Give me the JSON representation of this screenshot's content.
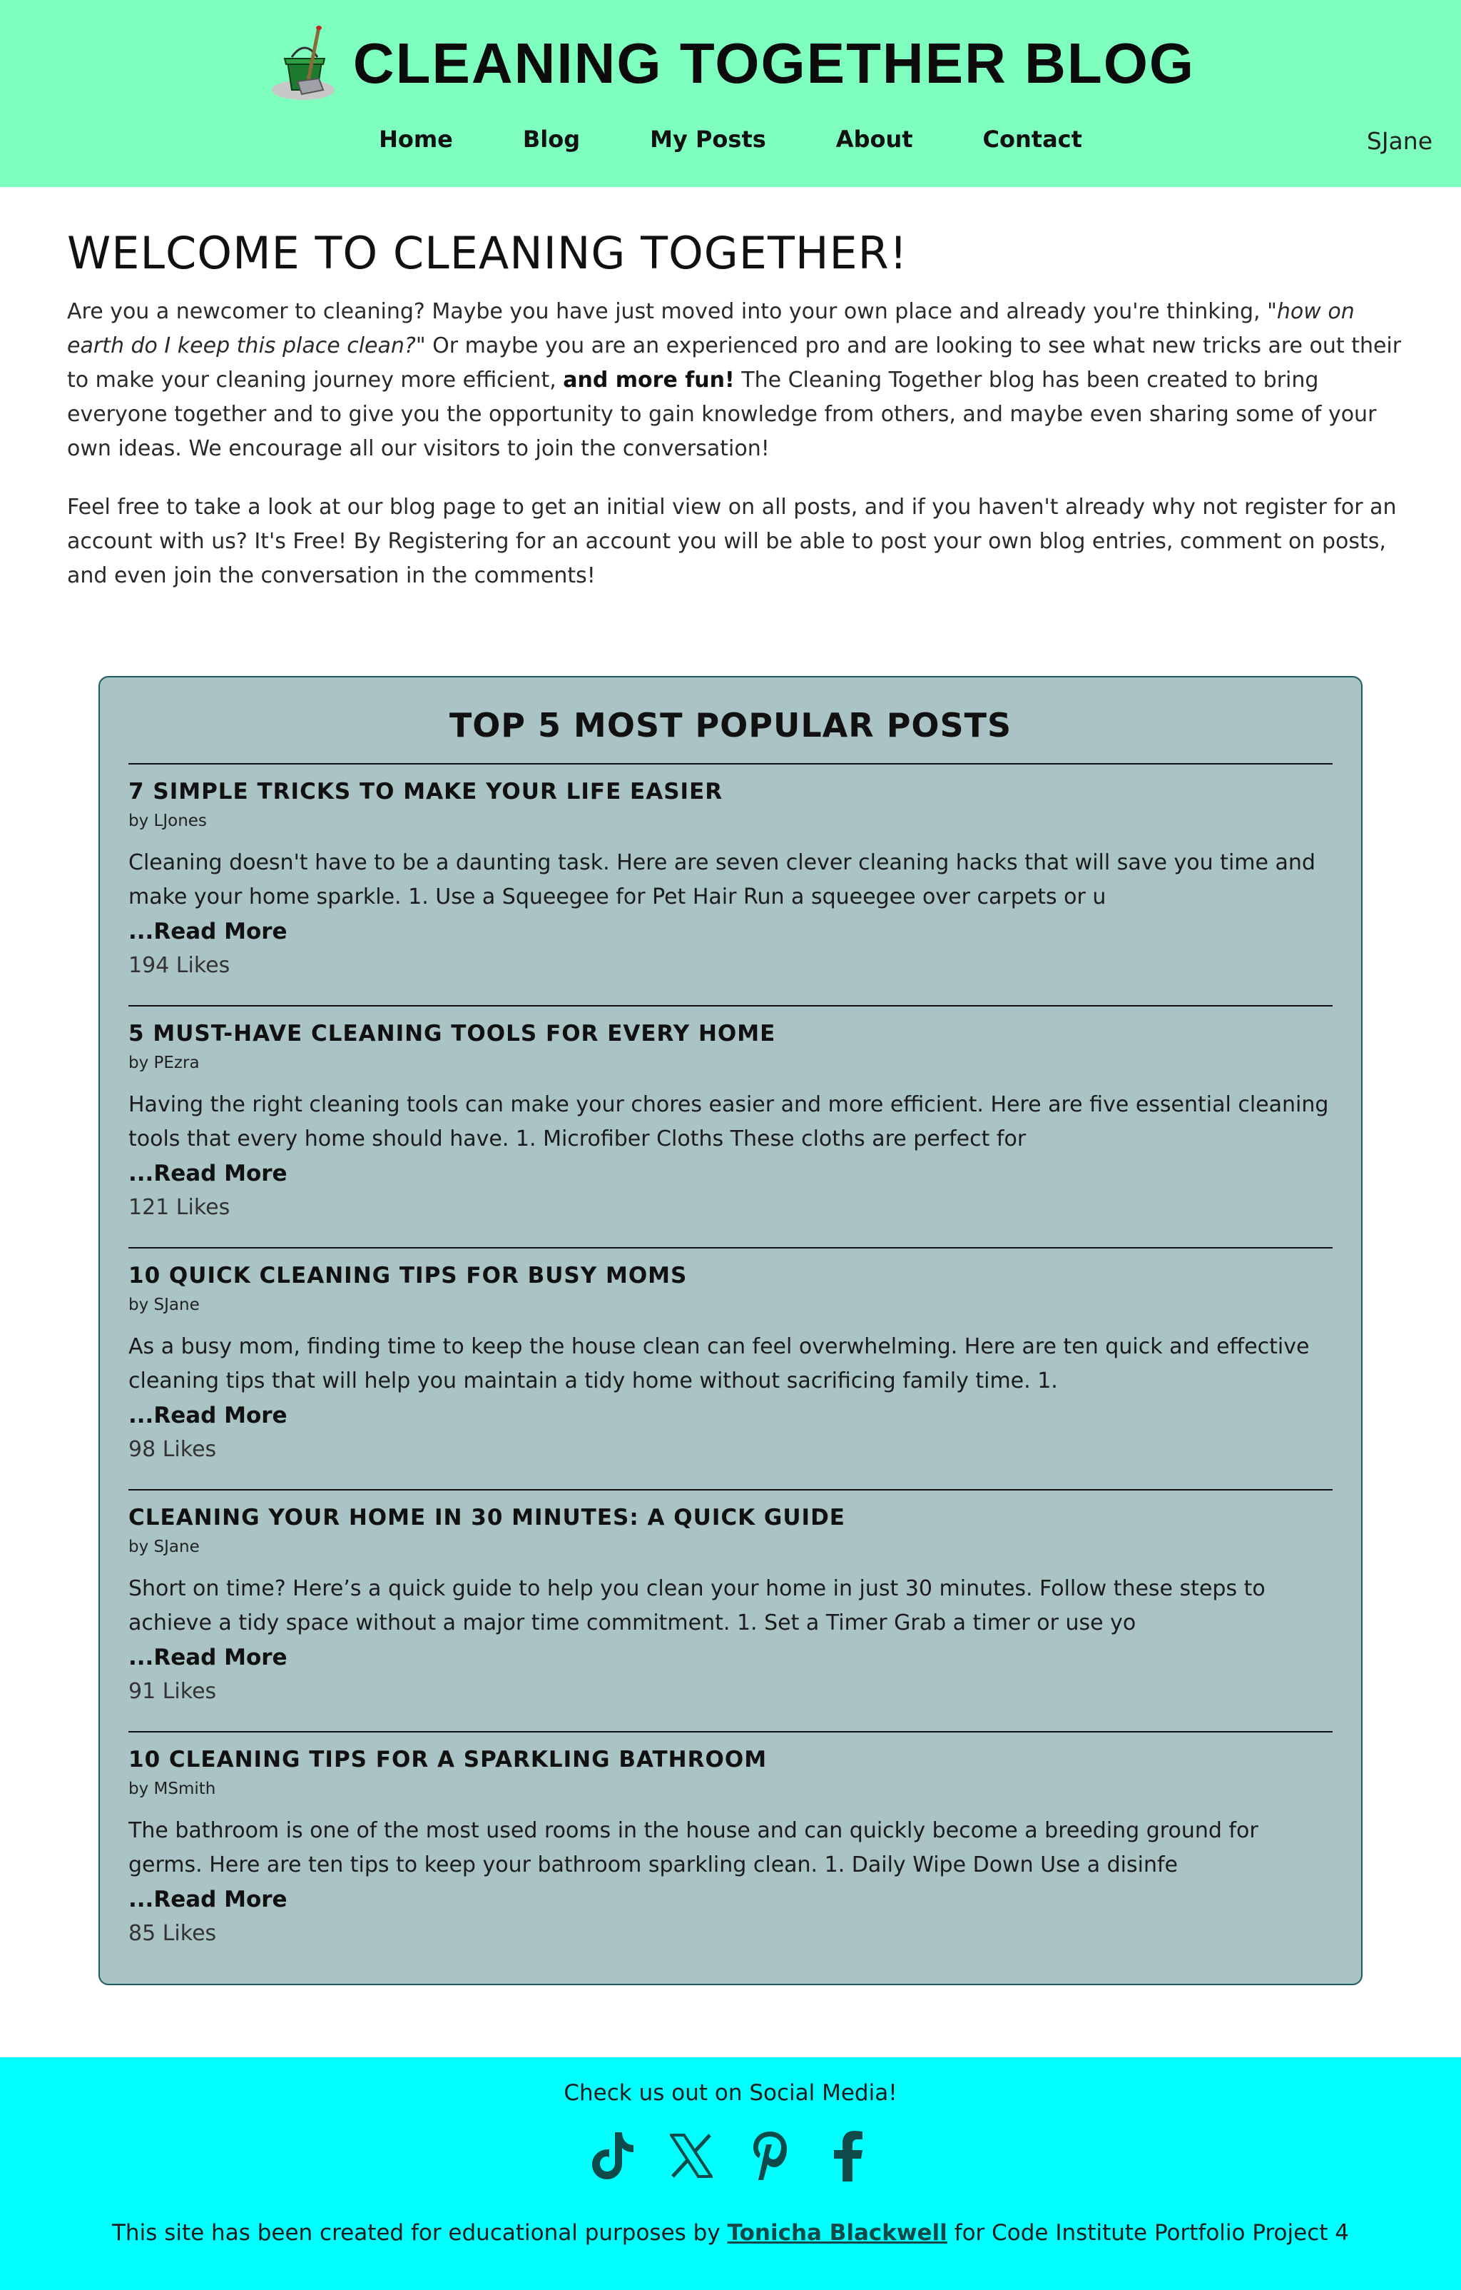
{
  "header": {
    "title": "CLEANING TOGETHER BLOG",
    "logo_icon": "bucket-mop-icon",
    "nav": {
      "home": "Home",
      "blog": "Blog",
      "my_posts": "My Posts",
      "about": "About",
      "contact": "Contact"
    },
    "user": "SJane"
  },
  "welcome": {
    "title": "WELCOME TO CLEANING TOGETHER!",
    "p1_a": "Are you a newcomer to cleaning? Maybe you have just moved into your own place and already you're thinking, \"",
    "p1_quote": "how on earth do I keep this place clean?",
    "p1_b": "\" Or maybe you are an experienced pro and are looking to see what new tricks are out their to make your cleaning journey more efficient, ",
    "p1_bold": "and more fun!",
    "p1_c": " The Cleaning Together blog has been created to bring everyone together and to give you the opportunity to gain knowledge from others, and maybe even sharing some of your own ideas. We encourage all our visitors to join the conversation!",
    "p2": "Feel free to take a look at our blog page to get an initial view on all posts, and if you haven't already why not register for an account with us? It's Free! By Registering for an account you will be able to post your own blog entries, comment on posts, and even join the conversation in the comments!"
  },
  "popular": {
    "title": "TOP 5 MOST POPULAR POSTS",
    "read_more": "...Read More",
    "posts": [
      {
        "title": "7 SIMPLE TRICKS TO MAKE YOUR LIFE EASIER",
        "author": "by LJones",
        "excerpt": "Cleaning doesn't have to be a daunting task. Here are seven clever cleaning hacks that will save you time and make your home sparkle. 1. Use a Squeegee for Pet Hair Run a squeegee over carpets or u",
        "likes": "194 Likes"
      },
      {
        "title": "5 MUST-HAVE CLEANING TOOLS FOR EVERY HOME",
        "author": "by PEzra",
        "excerpt": "Having the right cleaning tools can make your chores easier and more efficient. Here are five essential cleaning tools that every home should have. 1. Microfiber Cloths These cloths are perfect for",
        "likes": "121 Likes"
      },
      {
        "title": "10 QUICK CLEANING TIPS FOR BUSY MOMS",
        "author": "by SJane",
        "excerpt": "As a busy mom, finding time to keep the house clean can feel overwhelming. Here are ten quick and effective cleaning tips that will help you maintain a tidy home without sacrificing family time. 1.",
        "likes": "98 Likes"
      },
      {
        "title": "CLEANING YOUR HOME IN 30 MINUTES: A QUICK GUIDE",
        "author": "by SJane",
        "excerpt": "Short on time? Here’s a quick guide to help you clean your home in just 30 minutes. Follow these steps to achieve a tidy space without a major time commitment. 1. Set a Timer Grab a timer or use yo",
        "likes": "91 Likes"
      },
      {
        "title": "10 CLEANING TIPS FOR A SPARKLING BATHROOM",
        "author": "by MSmith",
        "excerpt": "The bathroom is one of the most used rooms in the house and can quickly become a breeding ground for germs. Here are ten tips to keep your bathroom sparkling clean. 1. Daily Wipe Down Use a disinfe",
        "likes": "85 Likes"
      }
    ]
  },
  "footer": {
    "social_title": "Check us out on Social Media!",
    "icons": [
      "tiktok-icon",
      "x-icon",
      "pinterest-icon",
      "facebook-icon"
    ],
    "credit_a": "This site has been created for educational purposes by ",
    "credit_link": "Tonicha Blackwell",
    "credit_b": " for Code Institute Portfolio Project 4"
  },
  "colors": {
    "header_bg": "#7fffbf",
    "panel_bg": "#aac4c6",
    "panel_border": "#1e5b5e",
    "footer_bg": "#00ffff",
    "icon_color": "#0e4a4a"
  }
}
